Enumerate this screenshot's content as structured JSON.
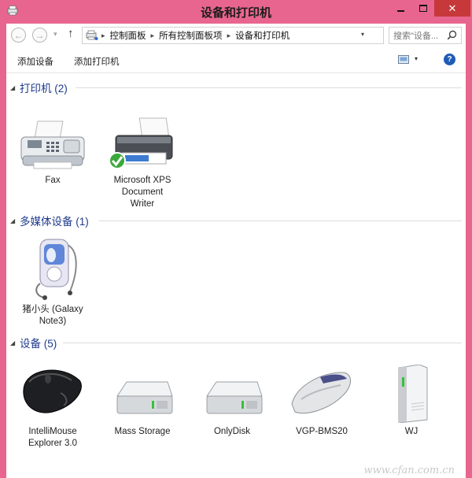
{
  "window": {
    "title": "设备和打印机"
  },
  "address": {
    "crumbs": [
      "控制面板",
      "所有控制面板项",
      "设备和打印机"
    ],
    "search_placeholder": "搜索\"设备..."
  },
  "toolbar": {
    "add_device": "添加设备",
    "add_printer": "添加打印机",
    "help": "?"
  },
  "groups": {
    "printers": {
      "title": "打印机 (2)"
    },
    "media": {
      "title": "多媒体设备 (1)"
    },
    "devices": {
      "title": "设备 (5)"
    }
  },
  "items": {
    "fax": "Fax",
    "xps_1": "Microsoft XPS",
    "xps_2": "Document",
    "xps_3": "Writer",
    "phone_1": "猪小头 (Galaxy",
    "phone_2": "Note3)",
    "mouse_1": "IntelliMouse",
    "mouse_2": "Explorer 3.0",
    "mass_storage": "Mass Storage",
    "onlydisk": "OnlyDisk",
    "vgp": "VGP-BMS20",
    "wj": "WJ"
  },
  "watermark": "www.cfan.com.cn",
  "colors": {
    "titlebar": "#e8658f",
    "close": "#c7383b",
    "group_title": "#1e3a8c",
    "help": "#1f5bb5"
  }
}
